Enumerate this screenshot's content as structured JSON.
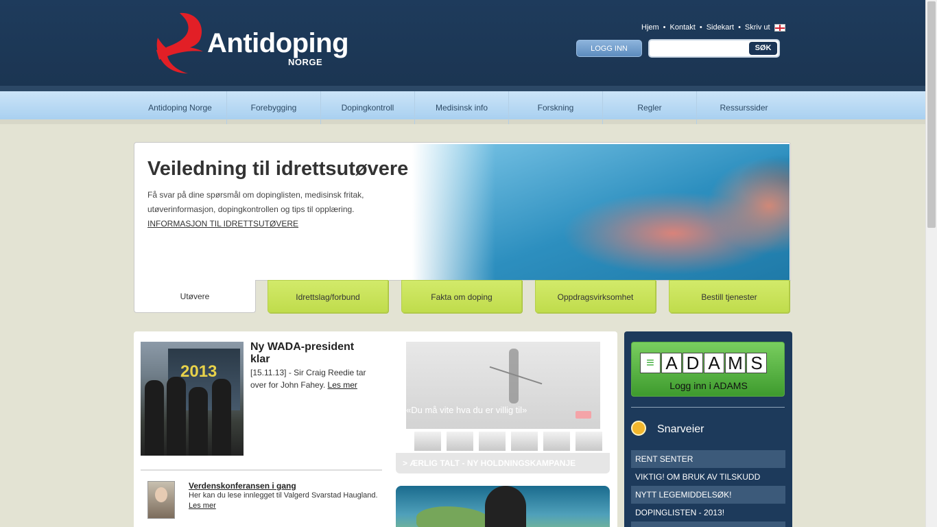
{
  "header": {
    "logo_text": "Antidoping",
    "logo_sub": "NORGE",
    "links": [
      "Hjem",
      "Kontakt",
      "Sidekart",
      "Skriv ut"
    ],
    "login_label": "LOGG INN",
    "search_value": "",
    "search_button": "SØK"
  },
  "nav": {
    "items": [
      "Antidoping Norge",
      "Forebygging",
      "Dopingkontroll",
      "Medisinsk info",
      "Forskning",
      "Regler",
      "Ressurssider"
    ]
  },
  "hero": {
    "title": "Veiledning til idrettsutøvere",
    "text": "Få svar på dine spørsmål om dopinglisten, medisinsk fritak, utøverinformasjon, dopingkontrollen og tips til opplæring.",
    "link": "INFORMASJON TIL IDRETTSUTØVERE",
    "tabs": [
      "Utøvere",
      "Idrettslag/forbund",
      "Fakta om doping",
      "Oppdragsvirksomhet",
      "Bestill tjenester"
    ]
  },
  "news": {
    "title": "Ny WADA-president klar",
    "meta": "[15.11.13] - Sir Craig Reedie tar over for John Fahey.",
    "more": "Les mer",
    "image_text": "2013",
    "secondary_title": "Verdenskonferansen i gang",
    "secondary_text": "Her kan du lese innlegget til Valgerd Svarstad Haugland.",
    "secondary_more": "Les mer"
  },
  "campaign": {
    "caption": "«Du må vite hva du er villig til»",
    "bar": "> ÆRLIG TALT - NY HOLDNINGSKAMPANJE"
  },
  "sidebar": {
    "adams_letters": [
      "A",
      "D",
      "A",
      "M",
      "S"
    ],
    "adams_label": "Logg inn i ADAMS",
    "shortcuts_title": "Snarveier",
    "shortcuts": [
      "RENT SENTER",
      "VIKTIG! OM BRUK AV TILSKUDD",
      "NYTT LEGEMIDDELSØK!",
      "DOPINGLISTEN - 2013!",
      ""
    ]
  },
  "colors": {
    "header_bg": "#1e3b5c",
    "nav_bg": "#b9daf4",
    "tab_green": "#c8e05a",
    "adams_green": "#4fae39",
    "sidebar_bg": "#1d3a5b"
  }
}
